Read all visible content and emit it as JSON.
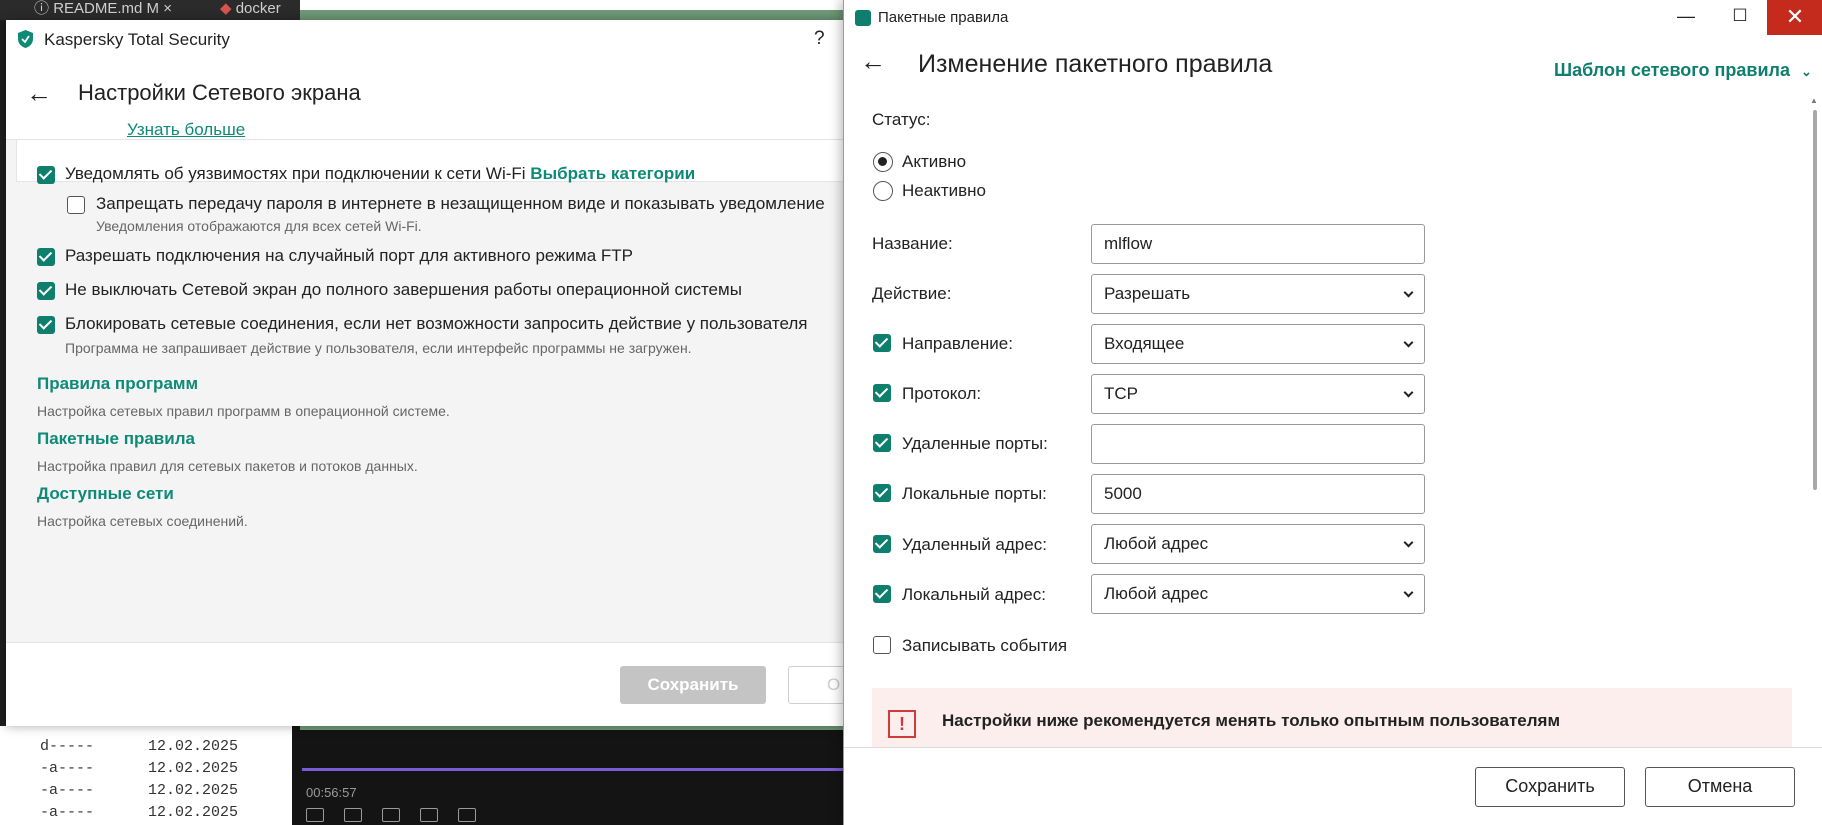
{
  "background": {
    "tabs": [
      {
        "label": "README.md M"
      },
      {
        "label": "docker"
      }
    ],
    "terminal_lines": [
      {
        "mode": "d-----",
        "date": "12.02.2025"
      },
      {
        "mode": "-a----",
        "date": "12.02.2025"
      },
      {
        "mode": "-a----",
        "date": "12.02.2025"
      },
      {
        "mode": "-a----",
        "date": "12.02.2025"
      }
    ],
    "media_time": "00:56:57"
  },
  "kaspersky": {
    "app_title": "Kaspersky Total Security",
    "help": "?",
    "page_title": "Настройки Сетевого экрана",
    "learn_more": "Узнать больше",
    "options": [
      {
        "label": "Уведомлять об уязвимостях при подключении к сети Wi-Fi",
        "link": "Выбрать категории",
        "checked": true
      },
      {
        "label": "Запрещать передачу пароля в интернете в незащищенном виде и показывать уведомление",
        "hint": "Уведомления отображаются для всех сетей Wi-Fi.",
        "checked": false
      },
      {
        "label": "Разрешать подключения на случайный порт для активного режима FTP",
        "checked": true
      },
      {
        "label": "Не выключать Сетевой экран до полного завершения работы операционной системы",
        "checked": true
      },
      {
        "label": "Блокировать сетевые соединения, если нет возможности запросить действие у пользователя",
        "hint": "Программа не запрашивает действие у пользователя, если интерфейс программы не загружен.",
        "checked": true
      }
    ],
    "sections": [
      {
        "title": "Правила программ",
        "description": "Настройка сетевых правил программ в операционной системе."
      },
      {
        "title": "Пакетные правила",
        "description": "Настройка правил для сетевых пакетов и потоков данных."
      },
      {
        "title": "Доступные сети",
        "description": "Настройка сетевых соединений."
      }
    ],
    "save_label": "Сохранить",
    "cancel_label": "О"
  },
  "packet_dialog": {
    "window_title": "Пакетные правила",
    "heading": "Изменение пакетного правила",
    "template_label": "Шаблон сетевого правила",
    "status_label": "Статус:",
    "status_options": [
      {
        "label": "Активно",
        "selected": true
      },
      {
        "label": "Неактивно",
        "selected": false
      }
    ],
    "name_label": "Название:",
    "name_value": "mlflow",
    "action_label": "Действие:",
    "action_value": "Разрешать",
    "direction_label": "Направление:",
    "direction_value": "Входящее",
    "direction_checked": true,
    "protocol_label": "Протокол:",
    "protocol_value": "TCP",
    "protocol_checked": true,
    "remote_ports_label": "Удаленные порты:",
    "remote_ports_value": "",
    "remote_ports_checked": true,
    "local_ports_label": "Локальные порты:",
    "local_ports_value": "5000",
    "local_ports_checked": true,
    "remote_address_label": "Удаленный адрес:",
    "remote_address_value": "Любой адрес",
    "remote_address_checked": true,
    "local_address_label": "Локальный адрес:",
    "local_address_value": "Любой адрес",
    "local_address_checked": true,
    "log_events_label": "Записывать события",
    "log_events_checked": false,
    "warning_icon": "!",
    "warning_text": "Настройки ниже рекомендуется менять только опытным пользователям",
    "save_label": "Сохранить",
    "cancel_label": "Отмена"
  }
}
